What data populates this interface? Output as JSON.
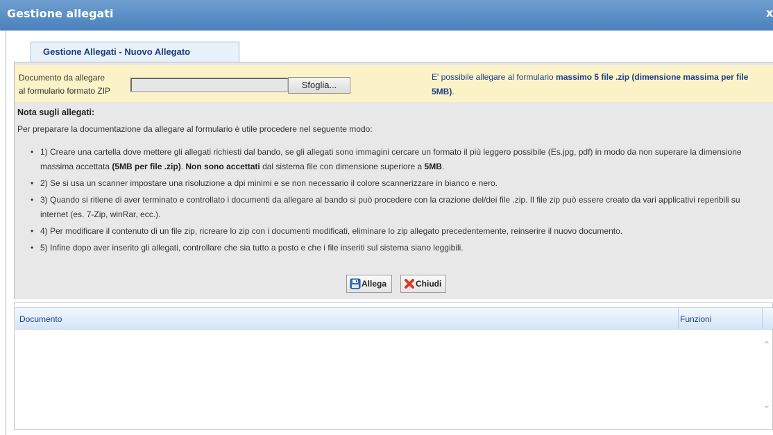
{
  "window": {
    "title": "Gestione allegati",
    "close_label": "x"
  },
  "form": {
    "header": "Gestione Allegati - Nuovo Allegato",
    "doc_label_line1": "Documento da allegare",
    "doc_label_line2": "al formulario formato ZIP",
    "file_value": "",
    "browse_label": "Sfoglia...",
    "limit_prefix": "E' possibile allegare al formulario ",
    "limit_bold": "massimo 5 file .zip (dimensione massima per file 5MB)",
    "limit_suffix": "."
  },
  "notes": {
    "title": "Nota sugli allegati:",
    "intro": "Per preparare la documentazione da allegare al formulario è utile procedere nel seguente modo:",
    "b1_a": "1) Creare una cartella dove mettere gli allegati richiesti dal bando, se gli allegati sono immagini cercare un formato il più leggero possibile (Es.jpg, pdf) in modo da non superare la dimensione massima accettata ",
    "b1_b": "(5MB per file .zip)",
    "b1_c": ". ",
    "b1_d": "Non sono accettati",
    "b1_e": " dal sistema file con dimensione superiore a ",
    "b1_f": "5MB",
    "b1_g": ".",
    "b2": "2) Se si usa un scanner impostare una risoluzione a dpi minimi e se non necessario il colore scannerizzare in bianco e nero.",
    "b3": "3) Quando si ritiene di aver terminato e controllato i documenti da allegare al bando si può procedere con la crazione del/dei file .zip. Il file zip può essere creato da vari applicativi reperibili su internet (es. 7-Zip, winRar, ecc.).",
    "b4": "4) Per modificare il contenuto di un file zip, ricreare lo zip con i documenti modificati, eliminare lo zip allegato precedentemente, reinserire il nuovo documento.",
    "b5": "5) Infine dopo aver inserito gli allegati, controllare che sia tutto a posto e che i file inseriti sul sistema siano leggibili."
  },
  "buttons": {
    "allega": "Allega",
    "chiudi": "Chiudi"
  },
  "table": {
    "col_documento": "Documento",
    "col_funzioni": "Funzioni",
    "rows": []
  },
  "colors": {
    "titlebar": "#5588c4",
    "info_band": "#fbf3c7",
    "panel": "#e8e8e8",
    "link_text": "#1b3f8a"
  },
  "icons": {
    "allega": "floppy-disk-icon",
    "chiudi": "red-x-icon"
  }
}
